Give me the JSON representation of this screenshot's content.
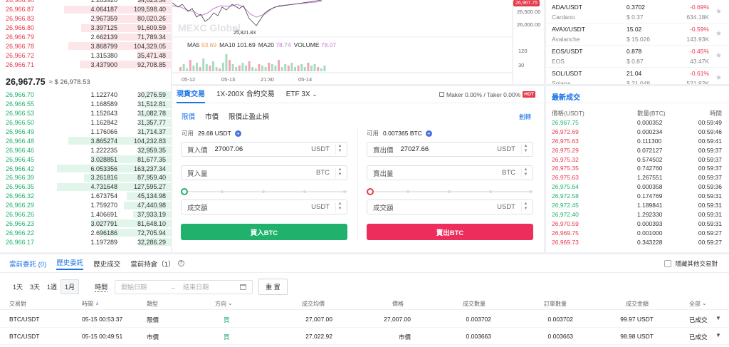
{
  "orderbook": {
    "asks": [
      {
        "price": "26,966.90",
        "amount": "1.283920",
        "total": "34,623.34",
        "fill": 0.29
      },
      {
        "price": "26,966.87",
        "amount": "4.064187",
        "total": "109,598.40",
        "fill": 0.94
      },
      {
        "price": "26,966.83",
        "amount": "2.967359",
        "total": "80,020.26",
        "fill": 0.69
      },
      {
        "price": "26,966.80",
        "amount": "3.397125",
        "total": "91,609.59",
        "fill": 0.79
      },
      {
        "price": "26,966.79",
        "amount": "2.662139",
        "total": "71,789.34",
        "fill": 0.62
      },
      {
        "price": "26,966.78",
        "amount": "3.868799",
        "total": "104,329.05",
        "fill": 0.9
      },
      {
        "price": "26,966.72",
        "amount": "1.315380",
        "total": "35,471.48",
        "fill": 0.3
      },
      {
        "price": "26,966.71",
        "amount": "3.437900",
        "total": "92,708.85",
        "fill": 0.8
      }
    ],
    "last_price": "26,967.75",
    "last_price_fiat": "≈ $ 26,978.53",
    "bids": [
      {
        "price": "26,966.70",
        "amount": "1.122740",
        "total": "30,276.59",
        "fill": 0.26
      },
      {
        "price": "26,966.55",
        "amount": "1.168589",
        "total": "31,512.81",
        "fill": 0.27
      },
      {
        "price": "26,966.53",
        "amount": "1.152643",
        "total": "31,082.78",
        "fill": 0.27
      },
      {
        "price": "26,966.50",
        "amount": "1.162842",
        "total": "31,357.77",
        "fill": 0.27
      },
      {
        "price": "26,966.49",
        "amount": "1.176066",
        "total": "31,714.37",
        "fill": 0.27
      },
      {
        "price": "26,966.48",
        "amount": "3.865274",
        "total": "104,232.83",
        "fill": 0.9
      },
      {
        "price": "26,966.46",
        "amount": "1.222235",
        "total": "32,959.35",
        "fill": 0.28
      },
      {
        "price": "26,966.45",
        "amount": "3.028851",
        "total": "81,677.35",
        "fill": 0.7
      },
      {
        "price": "26,966.42",
        "amount": "6.053356",
        "total": "163,237.34",
        "fill": 1.0
      },
      {
        "price": "26,966.39",
        "amount": "3.261816",
        "total": "87,959.40",
        "fill": 0.76
      },
      {
        "price": "26,966.35",
        "amount": "4.731648",
        "total": "127,595.27",
        "fill": 1.0
      },
      {
        "price": "26,966.32",
        "amount": "1.673754",
        "total": "45,134.98",
        "fill": 0.39
      },
      {
        "price": "26,966.29",
        "amount": "1.759270",
        "total": "47,440.98",
        "fill": 0.41
      },
      {
        "price": "26,966.26",
        "amount": "1.406691",
        "total": "37,933.19",
        "fill": 0.33
      },
      {
        "price": "26,966.23",
        "amount": "3.027791",
        "total": "81,648.10",
        "fill": 0.7
      },
      {
        "price": "26,966.22",
        "amount": "2.696186",
        "total": "72,705.94",
        "fill": 0.63
      },
      {
        "price": "26,966.17",
        "amount": "1.197289",
        "total": "32,286.29",
        "fill": 0.28
      }
    ]
  },
  "chart": {
    "watermark": "MEXC Global",
    "low_marker": "25,821.83",
    "price_axis": [
      "26,500.00",
      "26,000.00"
    ],
    "price_tag": "26,967.75",
    "indicators": [
      {
        "label": "MA5",
        "value": "93.69",
        "color": "#e8a15a"
      },
      {
        "label": "MA10",
        "value": "101.69",
        "color": "#333333"
      },
      {
        "label": "MA20",
        "value": "78.74",
        "color": "#c77dd6"
      },
      {
        "label": "VOLUME",
        "value": "78.07",
        "color": "#c77dd6"
      }
    ],
    "volume_axis": [
      "120",
      "30"
    ],
    "time_axis": [
      "05-12",
      "05-13",
      "21:30",
      "05-14"
    ]
  },
  "trade_form": {
    "tabs": [
      "現貨交易",
      "1X-200X 合約交易",
      "ETF 3X"
    ],
    "fee_text": "Maker 0.00% / Taker 0.00%",
    "hot_badge": "HOT",
    "order_types": [
      "限價",
      "市價",
      "限價止盈止損"
    ],
    "tutorial_link": "劃轉",
    "buy": {
      "available_label": "可用",
      "available": "29.68 USDT",
      "price_label": "買入價",
      "price": "27007.06",
      "price_unit": "USDT",
      "amount_label": "買入量",
      "amount_unit": "BTC",
      "total_label": "成交額",
      "total_unit": "USDT",
      "button": "買入BTC"
    },
    "sell": {
      "available_label": "可用",
      "available": "0.007365 BTC",
      "price_label": "賣出價",
      "price": "27027.66",
      "price_unit": "USDT",
      "amount_label": "賣出量",
      "amount_unit": "BTC",
      "total_label": "成交額",
      "total_unit": "USDT",
      "button": "賣出BTC"
    }
  },
  "ticker": [
    {
      "pair": "ADA/USDT",
      "name": "Cardano",
      "price": "0.3702",
      "fiat": "$ 0.37",
      "change": "-0.69%",
      "volume": "634.18K"
    },
    {
      "pair": "AVAX/USDT",
      "name": "Avalanche",
      "price": "15.02",
      "fiat": "$ 15.026",
      "change": "-0.59%",
      "volume": "143.93K"
    },
    {
      "pair": "EOS/USDT",
      "name": "EOS",
      "price": "0.878",
      "fiat": "$ 0.87",
      "change": "-0.45%",
      "volume": "43.47K"
    },
    {
      "pair": "SOL/USDT",
      "name": "Solana",
      "price": "21.04",
      "fiat": "$ 21.048",
      "change": "-0.61%",
      "volume": "521.82K"
    }
  ],
  "trades": {
    "title": "最新成交",
    "headers": [
      "價格(USDT)",
      "數量(BTC)",
      "時間"
    ],
    "rows": [
      {
        "price": "26,967.75",
        "qty": "0.000352",
        "time": "00:59:49",
        "side": "buy"
      },
      {
        "price": "26,972.69",
        "qty": "0.000234",
        "time": "00:59:46",
        "side": "sell"
      },
      {
        "price": "26,975.63",
        "qty": "0.111300",
        "time": "00:59:41",
        "side": "sell"
      },
      {
        "price": "26,975.29",
        "qty": "0.072127",
        "time": "00:59:37",
        "side": "sell"
      },
      {
        "price": "26,975.32",
        "qty": "0.574502",
        "time": "00:59:37",
        "side": "sell"
      },
      {
        "price": "26,975.35",
        "qty": "0.742760",
        "time": "00:59:37",
        "side": "sell"
      },
      {
        "price": "26,975.63",
        "qty": "1.267551",
        "time": "00:59:37",
        "side": "sell"
      },
      {
        "price": "26,975.64",
        "qty": "0.000358",
        "time": "00:59:36",
        "side": "buy"
      },
      {
        "price": "26,972.58",
        "qty": "0.174769",
        "time": "00:59:31",
        "side": "buy"
      },
      {
        "price": "26,972.45",
        "qty": "1.189841",
        "time": "00:59:31",
        "side": "buy"
      },
      {
        "price": "26,972.40",
        "qty": "1.292330",
        "time": "00:59:31",
        "side": "buy"
      },
      {
        "price": "26,970.59",
        "qty": "0.000393",
        "time": "00:59:31",
        "side": "sell"
      },
      {
        "price": "26,969.75",
        "qty": "0.001000",
        "time": "00:59:27",
        "side": "sell"
      },
      {
        "price": "26,969.73",
        "qty": "0.343228",
        "time": "00:59:27",
        "side": "sell"
      }
    ]
  },
  "orders": {
    "tabs": [
      "當前委託 (0)",
      "歷史委託",
      "歷史成交",
      "當前持倉（1）"
    ],
    "hide_other": "隱藏其他交易對",
    "periods": [
      "1天",
      "3天",
      "1週",
      "1月"
    ],
    "time_label": "時間",
    "start_placeholder": "開始日期",
    "end_placeholder": "結束日期",
    "reset": "重 置",
    "headers": [
      "交易對",
      "時間",
      "類型",
      "方向",
      "成交均價",
      "價格",
      "成交數量",
      "訂單數量",
      "成交金額",
      "全部"
    ],
    "rows": [
      {
        "pair": "BTC/USDT",
        "time": "05-15 00:53:37",
        "type": "限價",
        "side": "買",
        "avg": "27,007.00",
        "price": "27,007.00",
        "filled": "0.003702",
        "qty": "0.003702",
        "amount": "99.97 USDT",
        "status": "已成交"
      },
      {
        "pair": "BTC/USDT",
        "time": "05-15 00:49:51",
        "type": "市價",
        "side": "買",
        "avg": "27,022.92",
        "price": "市價",
        "filled": "0.003663",
        "qty": "0.003663",
        "amount": "98.98 USDT",
        "status": "已成交"
      }
    ]
  },
  "colors": {
    "buy": "#20b26c",
    "sell": "#e8394d",
    "accent": "#1a73e8"
  }
}
